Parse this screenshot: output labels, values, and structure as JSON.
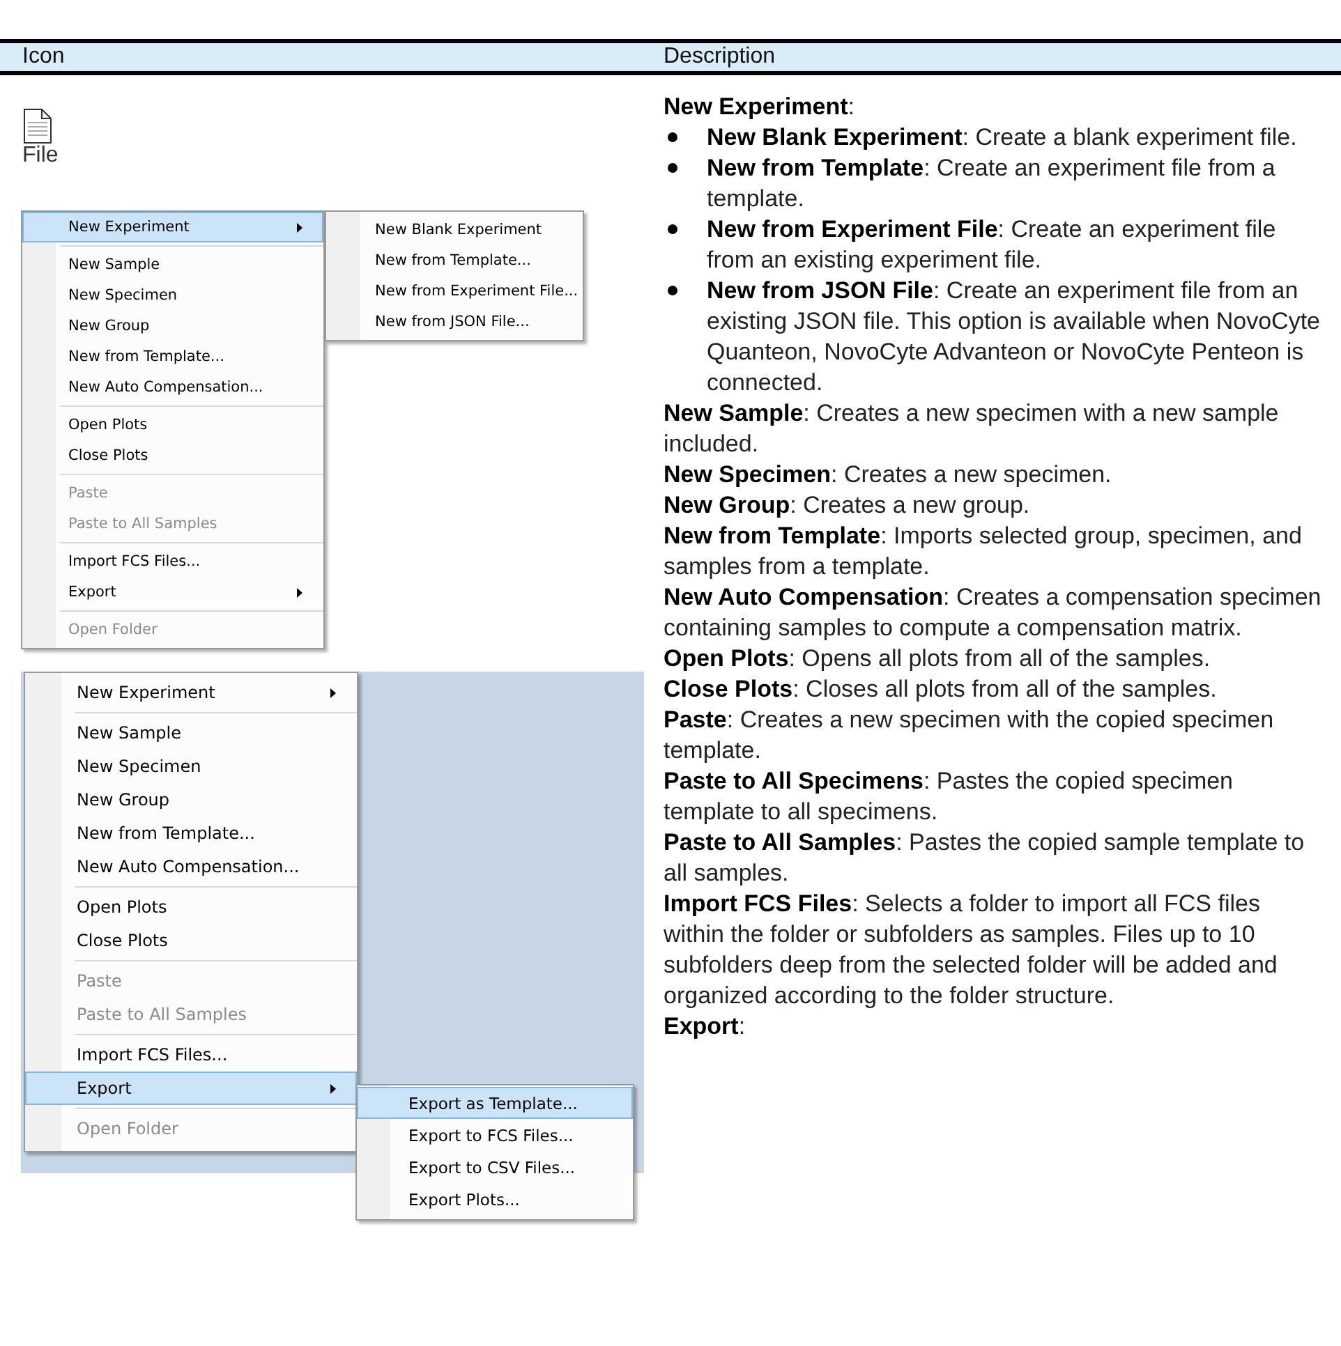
{
  "table": {
    "columns": [
      "Icon",
      "Description"
    ]
  },
  "icon_cell": {
    "label": "File"
  },
  "menu_1": {
    "items": [
      {
        "kind": "item",
        "label": "New Experiment",
        "selected": true,
        "disabled": false,
        "submenu": true
      },
      {
        "kind": "separator"
      },
      {
        "kind": "item",
        "label": "New Sample",
        "selected": false,
        "disabled": false,
        "submenu": false
      },
      {
        "kind": "item",
        "label": "New Specimen",
        "selected": false,
        "disabled": false,
        "submenu": false
      },
      {
        "kind": "item",
        "label": "New Group",
        "selected": false,
        "disabled": false,
        "submenu": false
      },
      {
        "kind": "item",
        "label": "New from Template...",
        "selected": false,
        "disabled": false,
        "submenu": false
      },
      {
        "kind": "item",
        "label": "New Auto Compensation...",
        "selected": false,
        "disabled": false,
        "submenu": false
      },
      {
        "kind": "separator"
      },
      {
        "kind": "item",
        "label": "Open Plots",
        "selected": false,
        "disabled": false,
        "submenu": false
      },
      {
        "kind": "item",
        "label": "Close Plots",
        "selected": false,
        "disabled": false,
        "submenu": false
      },
      {
        "kind": "separator"
      },
      {
        "kind": "item",
        "label": "Paste",
        "selected": false,
        "disabled": true,
        "submenu": false
      },
      {
        "kind": "item",
        "label": "Paste to All Samples",
        "selected": false,
        "disabled": true,
        "submenu": false
      },
      {
        "kind": "separator"
      },
      {
        "kind": "item",
        "label": "Import FCS Files...",
        "selected": false,
        "disabled": false,
        "submenu": false
      },
      {
        "kind": "item",
        "label": "Export",
        "selected": false,
        "disabled": false,
        "submenu": true
      },
      {
        "kind": "separator"
      },
      {
        "kind": "item",
        "label": "Open Folder",
        "selected": false,
        "disabled": true,
        "submenu": false
      }
    ],
    "submenu": {
      "items": [
        {
          "label": "New Blank Experiment",
          "selected": false
        },
        {
          "label": "New from Template...",
          "selected": false
        },
        {
          "label": "New from Experiment File...",
          "selected": false
        },
        {
          "label": "New from JSON File...",
          "selected": false
        }
      ]
    }
  },
  "menu_2": {
    "items": [
      {
        "kind": "item",
        "label": "New Experiment",
        "selected": false,
        "disabled": false,
        "submenu": true
      },
      {
        "kind": "separator"
      },
      {
        "kind": "item",
        "label": "New Sample",
        "selected": false,
        "disabled": false,
        "submenu": false
      },
      {
        "kind": "item",
        "label": "New Specimen",
        "selected": false,
        "disabled": false,
        "submenu": false
      },
      {
        "kind": "item",
        "label": "New Group",
        "selected": false,
        "disabled": false,
        "submenu": false
      },
      {
        "kind": "item",
        "label": "New from Template...",
        "selected": false,
        "disabled": false,
        "submenu": false
      },
      {
        "kind": "item",
        "label": "New Auto Compensation...",
        "selected": false,
        "disabled": false,
        "submenu": false
      },
      {
        "kind": "separator"
      },
      {
        "kind": "item",
        "label": "Open Plots",
        "selected": false,
        "disabled": false,
        "submenu": false
      },
      {
        "kind": "item",
        "label": "Close Plots",
        "selected": false,
        "disabled": false,
        "submenu": false
      },
      {
        "kind": "separator"
      },
      {
        "kind": "item",
        "label": "Paste",
        "selected": false,
        "disabled": true,
        "submenu": false
      },
      {
        "kind": "item",
        "label": "Paste to All Samples",
        "selected": false,
        "disabled": true,
        "submenu": false
      },
      {
        "kind": "separator"
      },
      {
        "kind": "item",
        "label": "Import FCS Files...",
        "selected": false,
        "disabled": false,
        "submenu": false
      },
      {
        "kind": "item",
        "label": "Export",
        "selected": true,
        "disabled": false,
        "submenu": true
      },
      {
        "kind": "separator"
      },
      {
        "kind": "item",
        "label": "Open Folder",
        "selected": false,
        "disabled": true,
        "submenu": false
      }
    ],
    "submenu": {
      "items": [
        {
          "label": "Export as Template...",
          "selected": true
        },
        {
          "label": "Export to FCS Files...",
          "selected": false
        },
        {
          "label": "Export to CSV Files...",
          "selected": false
        },
        {
          "label": "Export Plots...",
          "selected": false
        }
      ]
    }
  },
  "description": [
    {
      "kind": "para",
      "text": "**New Experiment**:"
    },
    {
      "kind": "bullet",
      "text": "**New Blank Experiment**: Create a blank experiment file."
    },
    {
      "kind": "bullet",
      "text": "**New from Template**: Create an experiment file from a template."
    },
    {
      "kind": "bullet",
      "text": "**New from Experiment File**: Create an experiment file from an existing experiment file."
    },
    {
      "kind": "bullet",
      "text": "**New from JSON File**: Create an experiment file from an existing JSON file. This option is available when NovoCyte Quanteon, NovoCyte Advanteon or NovoCyte Penteon is connected."
    },
    {
      "kind": "para",
      "text": "**New Sample**: Creates a new specimen with a new sample included."
    },
    {
      "kind": "para",
      "text": "**New Specimen**: Creates a new specimen."
    },
    {
      "kind": "para",
      "text": "**New Group**: Creates a new group."
    },
    {
      "kind": "para",
      "text": "**New from Template**: Imports selected group, specimen, and samples from a template."
    },
    {
      "kind": "para",
      "text": "**New Auto Compensation**: Creates a compensation specimen containing samples to compute a compensation matrix."
    },
    {
      "kind": "para",
      "text": "**Open Plots**: Opens all plots from all of the samples."
    },
    {
      "kind": "para",
      "text": "**Close Plots**: Closes all plots from all of the samples."
    },
    {
      "kind": "para",
      "text": "**Paste**: Creates a new specimen with the copied specimen template."
    },
    {
      "kind": "para",
      "text": "**Paste to All Specimens**: Pastes the copied specimen template to all specimens."
    },
    {
      "kind": "para",
      "text": "**Paste to All Samples**: Pastes the copied sample template to all samples."
    },
    {
      "kind": "para",
      "text": "**Import FCS Files**: Selects a folder to import all FCS files within the folder or subfolders as samples. Files up to 10 subfolders deep from the selected folder will be added and organized according to the folder structure."
    },
    {
      "kind": "para",
      "text": "**Export**:"
    }
  ]
}
